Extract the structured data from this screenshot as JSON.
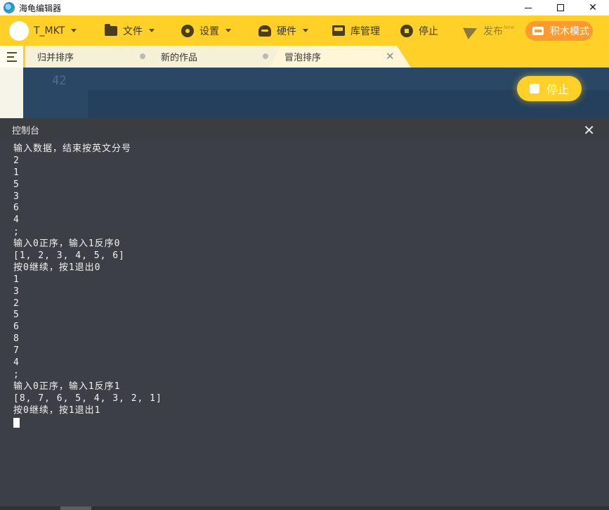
{
  "window": {
    "title": "海龟编辑器",
    "controls": {
      "minimize": "—",
      "maximize": "□",
      "close": "✕"
    }
  },
  "toolbar": {
    "user": "T_MKT",
    "file": "文件",
    "settings": "设置",
    "hardware": "硬件",
    "library": "库管理",
    "stop": "停止",
    "publish": "发布",
    "publish_badge": "New",
    "block_mode": "积木模式"
  },
  "tabs": [
    {
      "label": "归并排序",
      "active": false
    },
    {
      "label": "新的作品",
      "active": false
    },
    {
      "label": "冒泡排序",
      "active": true
    }
  ],
  "tab_close_symbol": "✕",
  "editor": {
    "line_number": "42",
    "run_stop_label": "停止"
  },
  "console": {
    "title": "控制台",
    "close_symbol": "✕",
    "lines": [
      "输入数据，结束按英文分号",
      "2",
      "1",
      "5",
      "3",
      "6",
      "4",
      ";",
      "输入0正序，输入1反序0",
      "[1, 2, 3, 4, 5, 6]",
      "按0继续，按1退出0",
      "1",
      "3",
      "2",
      "5",
      "6",
      "8",
      "7",
      "4",
      ";",
      "输入0正序，输入1反序1",
      "[8, 7, 6, 5, 4, 3, 2, 1]",
      "按0继续，按1退出1"
    ]
  },
  "colors": {
    "toolbar": "#ffd028",
    "block_mode": "#ff9a2e",
    "editor_bg": "#2b4766",
    "console_bg": "#3c3f45"
  }
}
